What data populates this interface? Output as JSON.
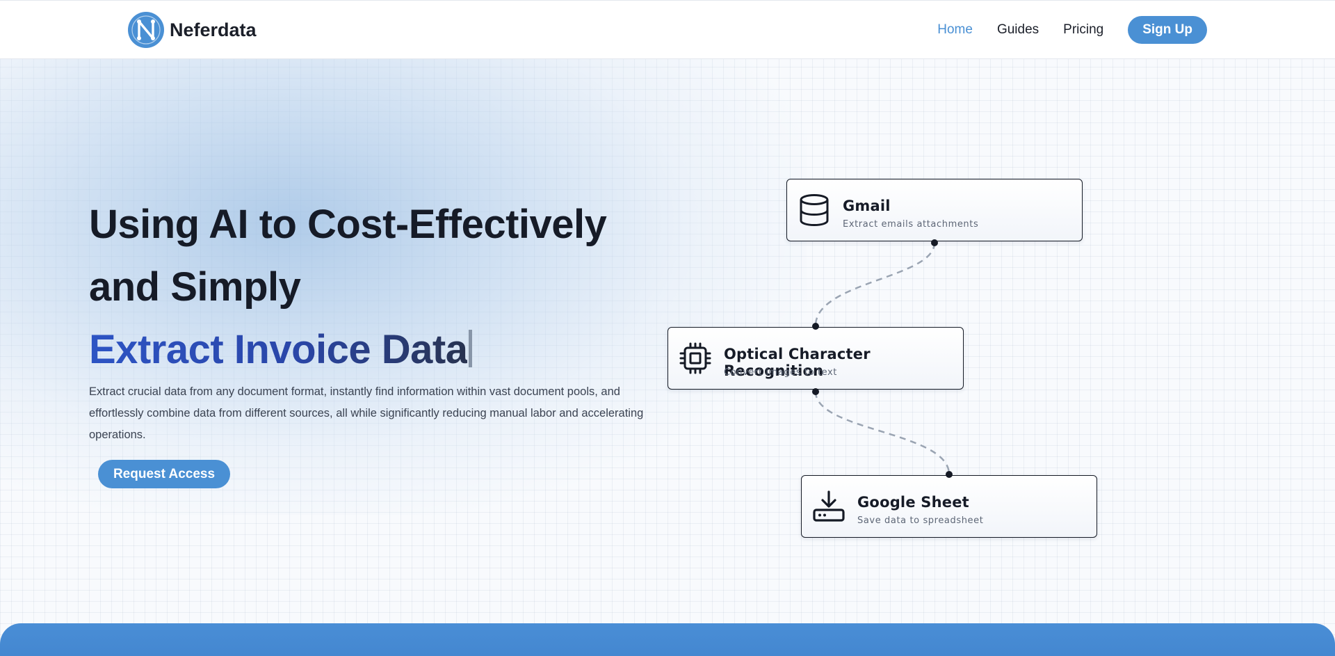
{
  "brand": {
    "name": "Neferdata",
    "logo_letter": "N"
  },
  "nav": {
    "links": [
      "Home",
      "Guides",
      "Pricing"
    ],
    "active": "Home",
    "signup_label": "Sign Up"
  },
  "hero": {
    "title_line1": "Using AI to Cost-Effectively",
    "title_line2": "and Simply",
    "title_accent": "Extract Invoice Data",
    "description": "Extract crucial data from any document format, instantly find information within vast document pools, and effortlessly combine data from different sources, all while significantly reducing manual labor and accelerating operations.",
    "cta_label": "Request Access"
  },
  "flow": {
    "nodes": [
      {
        "title": "Gmail",
        "subtitle": "Extract emails attachments",
        "icon": "database-icon"
      },
      {
        "title": "Optical Character Recognition",
        "subtitle": "Convert images to text",
        "icon": "cpu-chip-icon"
      },
      {
        "title": "Google Sheet",
        "subtitle": "Save data to spreadsheet",
        "icon": "download-drive-icon"
      }
    ]
  },
  "colors": {
    "accent": "#4a90d4",
    "accent_gradient_start": "#2d54c4",
    "text_dark": "#161b27",
    "footer_band": "#4a8ed6"
  }
}
